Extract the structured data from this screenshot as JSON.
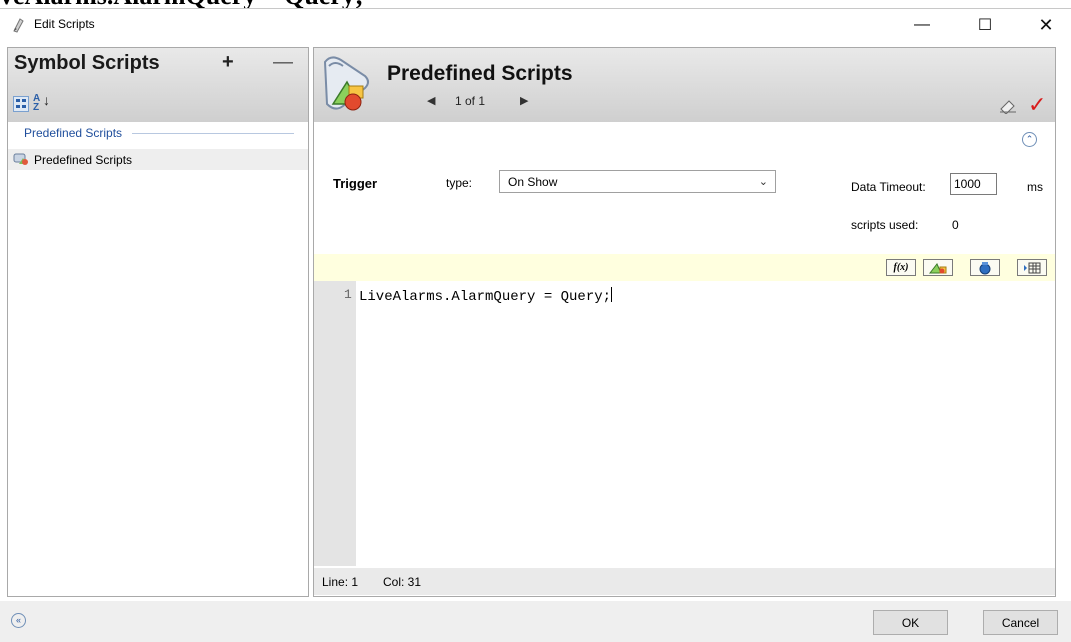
{
  "background": {
    "text": "veAlarms.AlarmQuery = Query;"
  },
  "window": {
    "title": "Edit Scripts",
    "minimize_glyph": "—",
    "maximize_glyph": "☐",
    "close_glyph": "✕"
  },
  "left_panel": {
    "title": "Symbol Scripts",
    "add_glyph": "+",
    "remove_glyph": "—",
    "sort_az_label": "A Z",
    "group_label": "Predefined Scripts",
    "items": [
      {
        "label": "Predefined Scripts",
        "icon": "script-scroll-icon"
      }
    ]
  },
  "right_panel": {
    "title": "Predefined Scripts",
    "pager": {
      "prev_glyph": "◀",
      "text": "1 of 1",
      "next_glyph": "▶"
    },
    "trigger": {
      "label": "Trigger",
      "type_label": "type:",
      "type_value": "On Show",
      "data_timeout_label": "Data Timeout:",
      "data_timeout_value": "1000",
      "ms_label": "ms",
      "scripts_used_label": "scripts used:",
      "scripts_used_value": "0"
    },
    "toolbar": {
      "fx_label": "f(x)"
    },
    "editor": {
      "lines": [
        {
          "number": "1",
          "text": "LiveAlarms.AlarmQuery = Query;"
        }
      ]
    },
    "status": {
      "line": "Line:  1",
      "col": "Col:  31"
    },
    "check_glyph": "✓",
    "collapse_glyph": "⌃"
  },
  "footer": {
    "ok_label": "OK",
    "cancel_label": "Cancel",
    "expand_glyph": "«"
  },
  "colors": {
    "accent": "#1f4e9c",
    "check": "#d81c1c",
    "tool_strip": "#ffffdf"
  }
}
